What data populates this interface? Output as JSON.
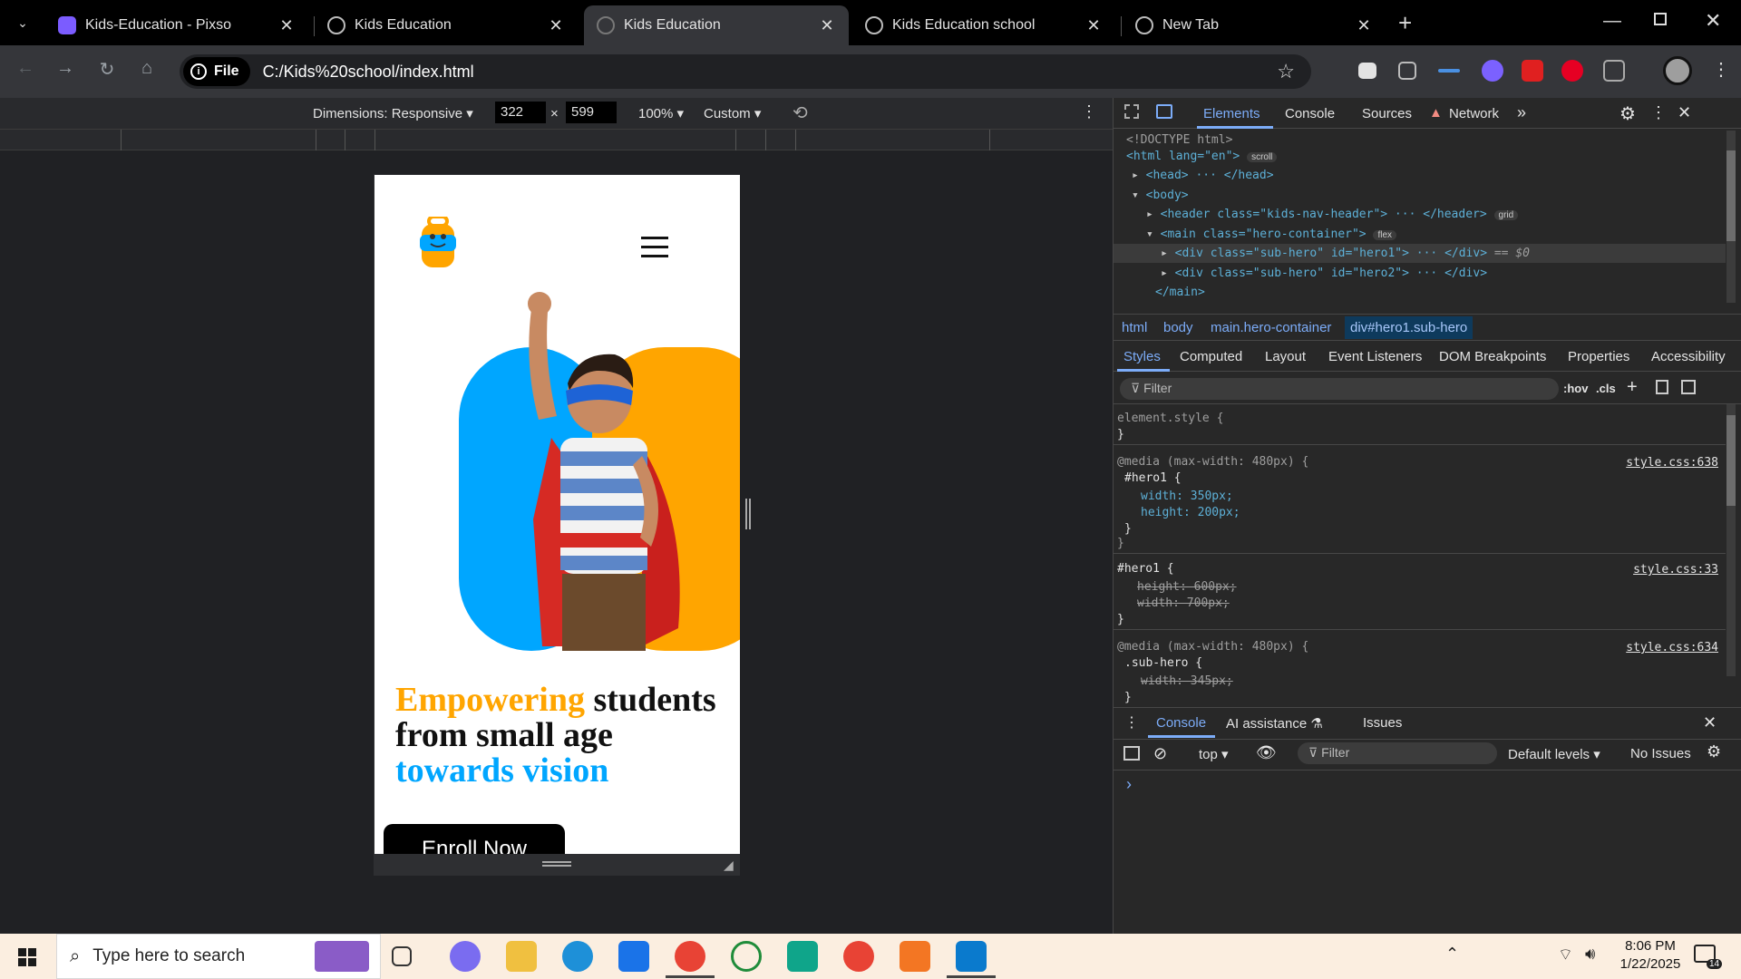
{
  "browser": {
    "tabs": [
      {
        "title": "Kids-Education - Pixso",
        "active": false
      },
      {
        "title": "Kids Education",
        "active": false
      },
      {
        "title": "Kids Education",
        "active": true
      },
      {
        "title": "Kids Education school",
        "active": false
      },
      {
        "title": "New Tab",
        "active": false
      }
    ],
    "file_chip": "File",
    "url": "C:/Kids%20school/index.html"
  },
  "device_toolbar": {
    "dimensions_label": "Dimensions: Responsive",
    "width": "322",
    "height": "599",
    "times": "×",
    "zoom": "100%",
    "throttle": "Custom"
  },
  "mobile_page": {
    "headline": {
      "word1": "Empowering",
      "word2": " students from small age ",
      "word3": "towards vision"
    },
    "enroll_label": "Enroll Now",
    "colors": {
      "orange": "#ffa500",
      "blue": "#00a6ff"
    }
  },
  "devtools": {
    "tabs": [
      "Elements",
      "Console",
      "Sources",
      "Network"
    ],
    "dom": {
      "doctype": "<!DOCTYPE html>",
      "html_open": "<html lang=\"en\">",
      "scroll_badge": "scroll",
      "head": "<head> ··· </head>",
      "body_open": "<body>",
      "header": "<header class=\"kids-nav-header\"> ··· </header>",
      "grid_badge": "grid",
      "main_open": "<main class=\"hero-container\">",
      "flex_badge": "flex",
      "div1": "<div class=\"sub-hero\" id=\"hero1\"> ··· </div>",
      "selected_marker": "== $0",
      "div2": "<div class=\"sub-hero\" id=\"hero2\"> ··· </div>",
      "main_close": "</main>"
    },
    "breadcrumbs": [
      "html",
      "body",
      "main.hero-container",
      "div#hero1.sub-hero"
    ],
    "style_tabs": [
      "Styles",
      "Computed",
      "Layout",
      "Event Listeners",
      "DOM Breakpoints",
      "Properties",
      "Accessibility"
    ],
    "filter_placeholder": "Filter",
    "hov": ":hov",
    "cls": ".cls",
    "rules": {
      "element_style": "element.style {",
      "close": "}",
      "media1": "@media (max-width: 480px) {",
      "media1_link": "style.css:638",
      "media1_sel": "#hero1 {",
      "media1_p1": "width: 350px;",
      "media1_p2": "height: 200px;",
      "rule2_sel": "#hero1 {",
      "rule2_link": "style.css:33",
      "rule2_p1": "height: 600px;",
      "rule2_p2": "width: 700px;",
      "media2": "@media (max-width: 480px) {",
      "media2_link": "style.css:634",
      "media2_sel": ".sub-hero {",
      "media2_p1": "width: 345px;"
    },
    "drawer": {
      "tabs": [
        "Console",
        "AI assistance",
        "Issues"
      ],
      "context": "top",
      "filter": "Filter",
      "levels": "Default levels",
      "issues": "No Issues",
      "prompt": "›"
    }
  },
  "taskbar": {
    "search_placeholder": "Type here to search",
    "time": "8:06 PM",
    "date": "1/22/2025",
    "notification_count": "14"
  }
}
